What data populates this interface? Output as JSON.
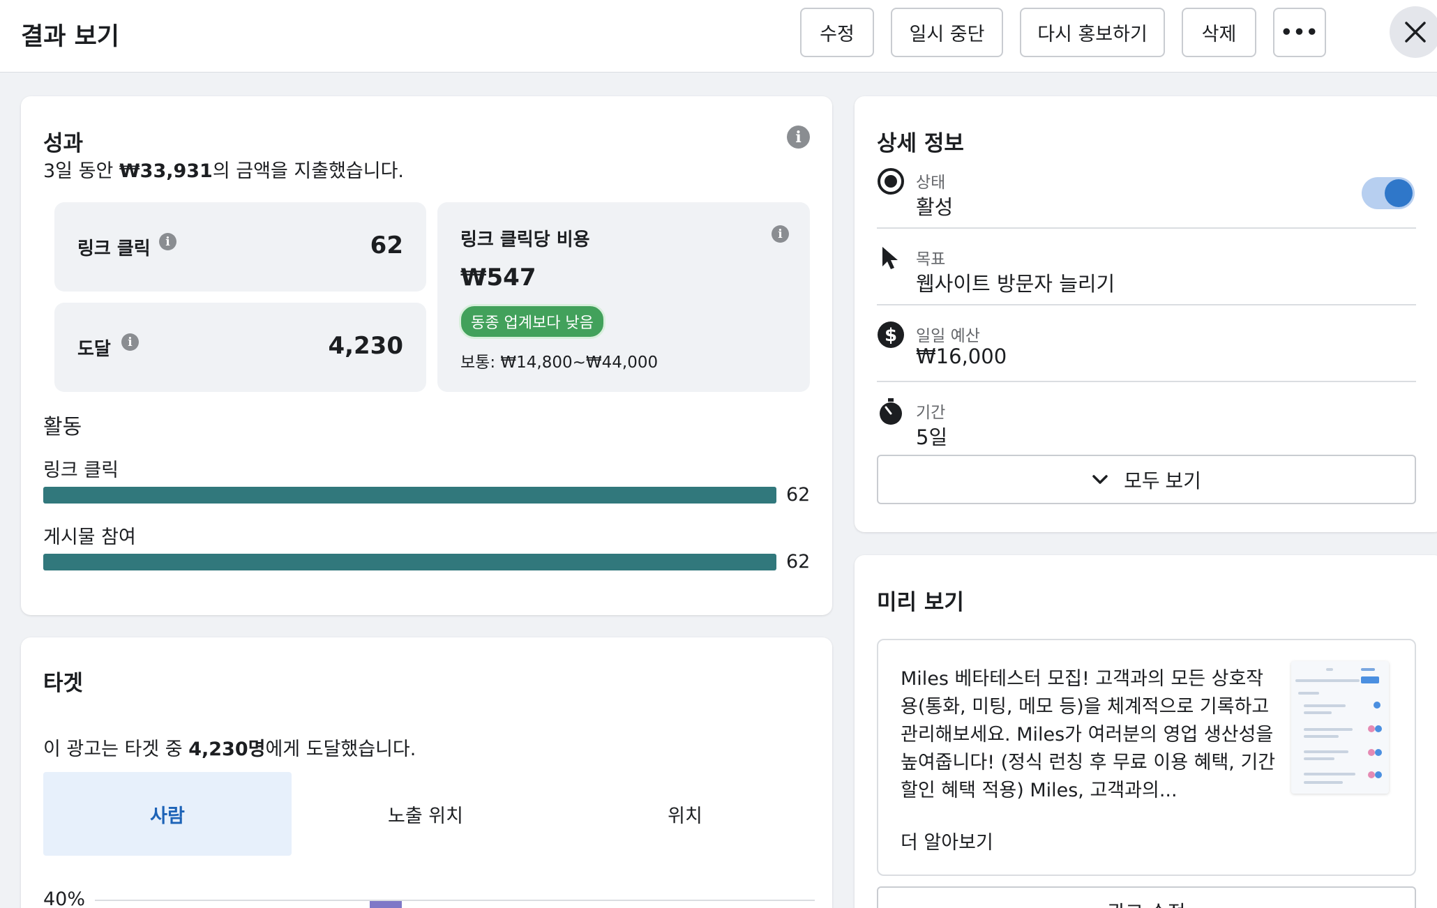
{
  "header": {
    "title": "결과 보기",
    "buttons": {
      "edit": "수정",
      "pause": "일시 중단",
      "repromote": "다시 홍보하기",
      "delete": "삭제",
      "more": "•••"
    }
  },
  "performance": {
    "title": "성과",
    "summary_prefix": "3일 동안 ",
    "summary_amount": "₩33,931",
    "summary_suffix": "의 금액을 지출했습니다.",
    "link_clicks": {
      "label": "링크 클릭",
      "value": "62"
    },
    "reach": {
      "label": "도달",
      "value": "4,230"
    },
    "cpc": {
      "label": "링크 클릭당 비용",
      "value": "₩547",
      "badge": "동종 업계보다 낮음",
      "range": "보통: ₩14,800~₩44,000"
    },
    "activity": {
      "title": "활동",
      "bars": [
        {
          "label": "링크 클릭",
          "value": "62",
          "fraction": 1.0
        },
        {
          "label": "게시물 참여",
          "value": "62",
          "fraction": 1.0
        }
      ]
    }
  },
  "target": {
    "title": "타겟",
    "summary_prefix": "이 광고는 타겟 중 ",
    "summary_count": "4,230명",
    "summary_suffix": "에게 도달했습니다.",
    "tabs": [
      "사람",
      "노출 위치",
      "위치"
    ],
    "chart_first_tick": "40%"
  },
  "details": {
    "title": "상세 정보",
    "status": {
      "label": "상태",
      "value": "활성",
      "enabled": true
    },
    "goal": {
      "label": "목표",
      "value": "웹사이트 방문자 늘리기"
    },
    "budget": {
      "label": "일일 예산",
      "value": "₩16,000"
    },
    "duration": {
      "label": "기간",
      "value": "5일"
    },
    "see_all": "모두 보기"
  },
  "preview": {
    "title": "미리 보기",
    "text": "Miles 베타테스터 모집! 고객과의 모든 상호작용(통화, 미팅, 메모 등)을 체계적으로 기록하고 관리해보세요. Miles가 여러분의 영업 생산성을 높여줍니다! (정식 런칭 후 무료 이용 혜택, 기간 할인 혜택 적용) Miles, 고객과의...",
    "learn_more": "더 알아보기",
    "bottom_button": "광고 수정"
  },
  "colors": {
    "bar": "#31787c",
    "badge": "#42a15b",
    "accent": "#2f77c9",
    "tab_active": "#1d63b7"
  }
}
